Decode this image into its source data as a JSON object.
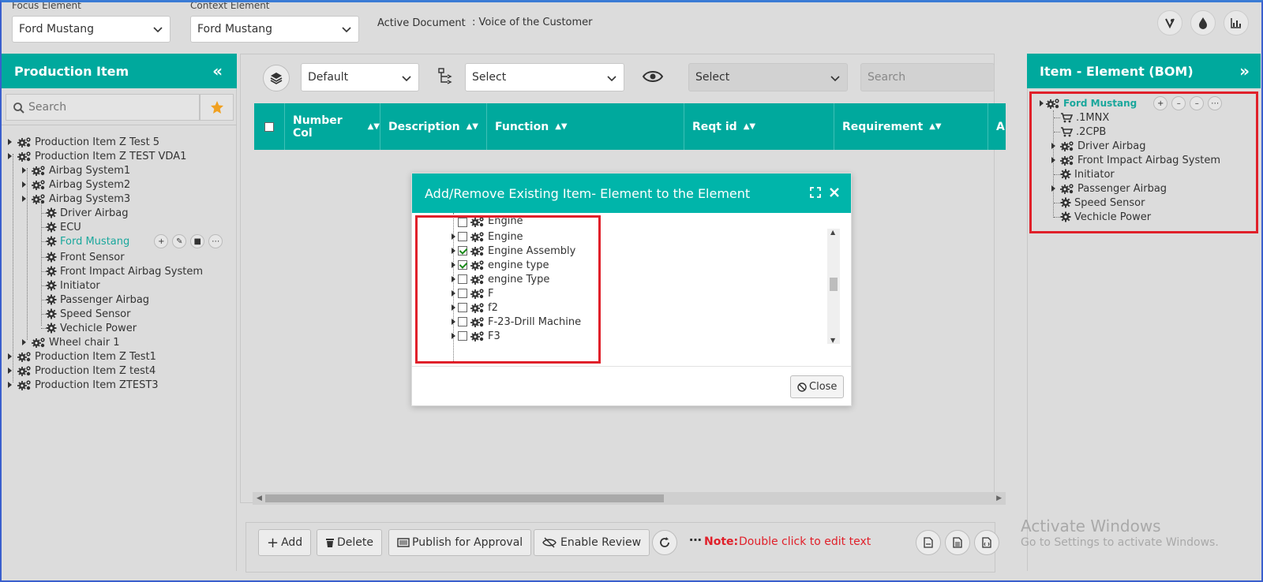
{
  "topbar": {
    "focus_label": "Focus Element",
    "focus_value": "Ford Mustang",
    "context_label": "Context Element",
    "context_value": "Ford Mustang",
    "active_doc_label": "Active Document",
    "active_doc_value": ": Voice of the Customer"
  },
  "left_panel": {
    "title": "Production Item",
    "search_placeholder": "Search",
    "tree": [
      {
        "label": "Production Item Z Test 5"
      },
      {
        "label": "Production Item Z TEST VDA1"
      },
      {
        "label": "Airbag System1"
      },
      {
        "label": "Airbag System2"
      },
      {
        "label": "Airbag System3"
      },
      {
        "label": "Driver Airbag"
      },
      {
        "label": "ECU"
      },
      {
        "label": "Ford Mustang"
      },
      {
        "label": "Front Sensor"
      },
      {
        "label": "Front Impact Airbag System"
      },
      {
        "label": "Initiator"
      },
      {
        "label": "Passenger Airbag"
      },
      {
        "label": "Speed Sensor"
      },
      {
        "label": "Vechicle Power"
      },
      {
        "label": "Wheel chair 1"
      },
      {
        "label": "Production Item Z Test1"
      },
      {
        "label": "Production Item Z test4"
      },
      {
        "label": "Production Item ZTEST3"
      }
    ]
  },
  "center": {
    "view_select": "Default",
    "filter_select": "Select",
    "visibility_select": "Select",
    "search_placeholder": "Search",
    "columns": [
      "Number Col",
      "Description",
      "Function",
      "Reqt id",
      "Requirement",
      "A"
    ]
  },
  "modal": {
    "title": "Add/Remove Existing Item- Element to the Element",
    "partial_top": "Engine",
    "items": [
      {
        "label": "Engine",
        "checked": false
      },
      {
        "label": "Engine Assembly",
        "checked": true
      },
      {
        "label": "engine type",
        "checked": true
      },
      {
        "label": "engine Type",
        "checked": false
      },
      {
        "label": "F",
        "checked": false
      },
      {
        "label": "f2",
        "checked": false
      },
      {
        "label": "F-23-Drill Machine",
        "checked": false
      },
      {
        "label": "F3",
        "checked": false
      }
    ],
    "close_label": "Close"
  },
  "right_panel": {
    "title": "Item - Element (BOM)",
    "root": "Ford Mustang",
    "children": [
      {
        "label": ".1MNX",
        "icon": "cart-icon"
      },
      {
        "label": ".2CPB",
        "icon": "cart-icon"
      },
      {
        "label": "Driver Airbag",
        "icon": "gears-icon"
      },
      {
        "label": "Front Impact Airbag System",
        "icon": "gears-icon"
      },
      {
        "label": "Initiator",
        "icon": "gear-icon"
      },
      {
        "label": "Passenger Airbag",
        "icon": "gears-icon"
      },
      {
        "label": "Speed Sensor",
        "icon": "gear-icon"
      },
      {
        "label": "Vechicle Power",
        "icon": "gear-icon"
      }
    ]
  },
  "bottombar": {
    "add_label": "Add",
    "delete_label": "Delete",
    "publish_label": "Publish for Approval",
    "review_label": "Enable Review",
    "note_label": "Note:",
    "note_text": "Double click to edit text"
  },
  "watermark": {
    "line1": "Activate Windows",
    "line2": "Go to Settings to activate Windows."
  },
  "colors": {
    "teal": "#00a99d",
    "modal_teal": "#00b5aa",
    "highlight_red": "#e0202a",
    "link_teal": "#1aa79c"
  }
}
